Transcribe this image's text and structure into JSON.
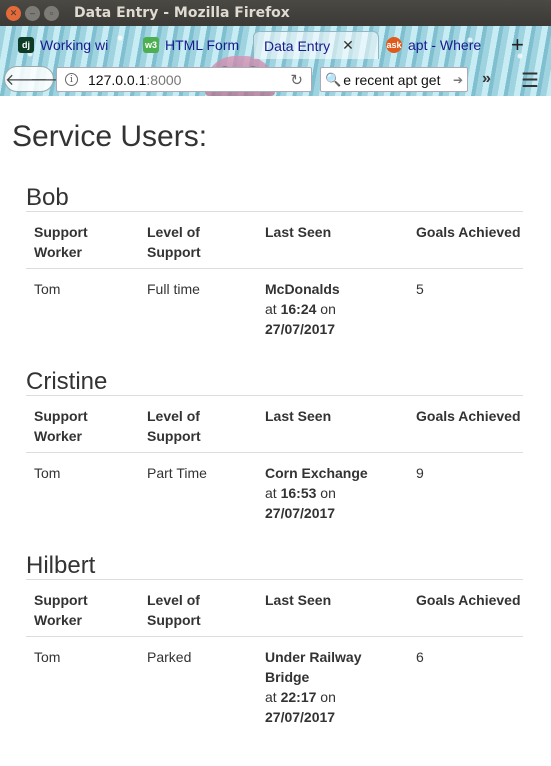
{
  "window": {
    "title": "Data Entry - Mozilla Firefox"
  },
  "tabs": [
    {
      "label": "Working wi",
      "favicon": "dj",
      "favicon_color": "#0c3c26",
      "active": false
    },
    {
      "label": "HTML Form",
      "favicon": "w3",
      "favicon_color": "#4caf50",
      "active": false
    },
    {
      "label": "Data Entry",
      "favicon": "",
      "active": true
    },
    {
      "label": "apt - Where",
      "favicon": "ask",
      "favicon_color": "#e05a1b",
      "active": false
    }
  ],
  "toolbar": {
    "url_host": "127.0.0.1",
    "url_port": ":8000",
    "search_text": "e recent apt get"
  },
  "page": {
    "title": "Service Users:",
    "columns": [
      "Support Worker",
      "Level of Support",
      "Last Seen",
      "Goals Achieved"
    ],
    "users": [
      {
        "name": "Bob",
        "worker": "Tom",
        "level": "Full time",
        "place": "McDonalds",
        "at": "at",
        "time": "16:24",
        "on": "on",
        "date": "27/07/2017",
        "goals": "5"
      },
      {
        "name": "Cristine",
        "worker": "Tom",
        "level": "Part Time",
        "place": "Corn Exchange",
        "at": "at",
        "time": "16:53",
        "on": "on",
        "date": "27/07/2017",
        "goals": "9"
      },
      {
        "name": "Hilbert",
        "worker": "Tom",
        "level": "Parked",
        "place": "Under Railway Bridge",
        "at": "at",
        "time": "22:17",
        "on": "on",
        "date": "27/07/2017",
        "goals": "6"
      }
    ]
  }
}
